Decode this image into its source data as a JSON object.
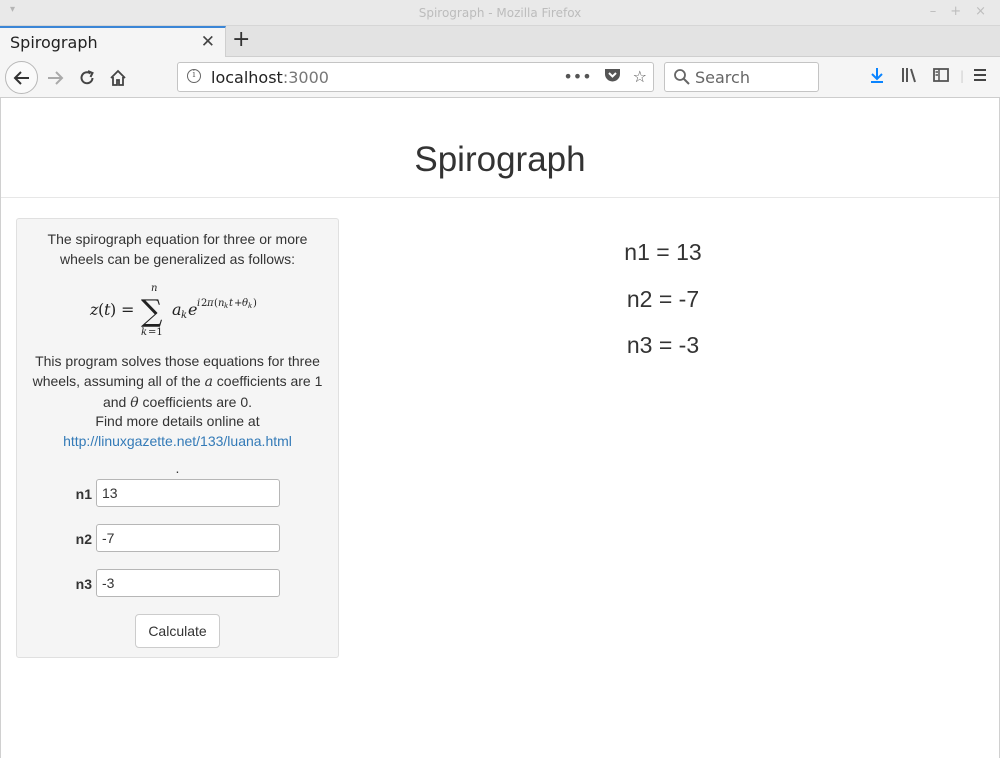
{
  "window": {
    "title": "Spirograph - Mozilla Firefox"
  },
  "tabs": [
    {
      "label": "Spirograph"
    }
  ],
  "toolbar": {
    "url_host": "localhost",
    "url_port": ":3000",
    "search_placeholder": "Search"
  },
  "page": {
    "title": "Spirograph",
    "intro": "The spirograph equation for three or more wheels can be generalized as follows:",
    "desc_part1": "This program solves those equations for three wheels, assuming all of the ",
    "desc_var_a": "a",
    "desc_part2": " coefficients are 1 and ",
    "desc_var_theta": "θ",
    "desc_part3": " coefficients are 0.",
    "details_text": "Find more details online at",
    "details_link": "http://linuxgazette.net/133/luana.html",
    "dot": ".",
    "fields": [
      {
        "label": "n1",
        "value": "13"
      },
      {
        "label": "n2",
        "value": "-7"
      },
      {
        "label": "n3",
        "value": "-3"
      }
    ],
    "calculate_label": "Calculate",
    "results": [
      "n1 = 13",
      "n2 = -7",
      "n3 = -3"
    ]
  },
  "icons": {
    "back": "back-arrow-icon",
    "forward": "forward-arrow-icon",
    "reload": "reload-icon",
    "home": "home-icon",
    "info": "info-icon",
    "more": "more-icon",
    "pocket": "pocket-icon",
    "bookmark": "star-icon",
    "search": "search-icon",
    "download": "download-icon",
    "library": "library-icon",
    "sidebar": "sidebar-icon",
    "menu": "hamburger-menu-icon"
  },
  "colors": {
    "accent": "#3b86d6",
    "link": "#337ab7",
    "download": "#0a84ff"
  }
}
